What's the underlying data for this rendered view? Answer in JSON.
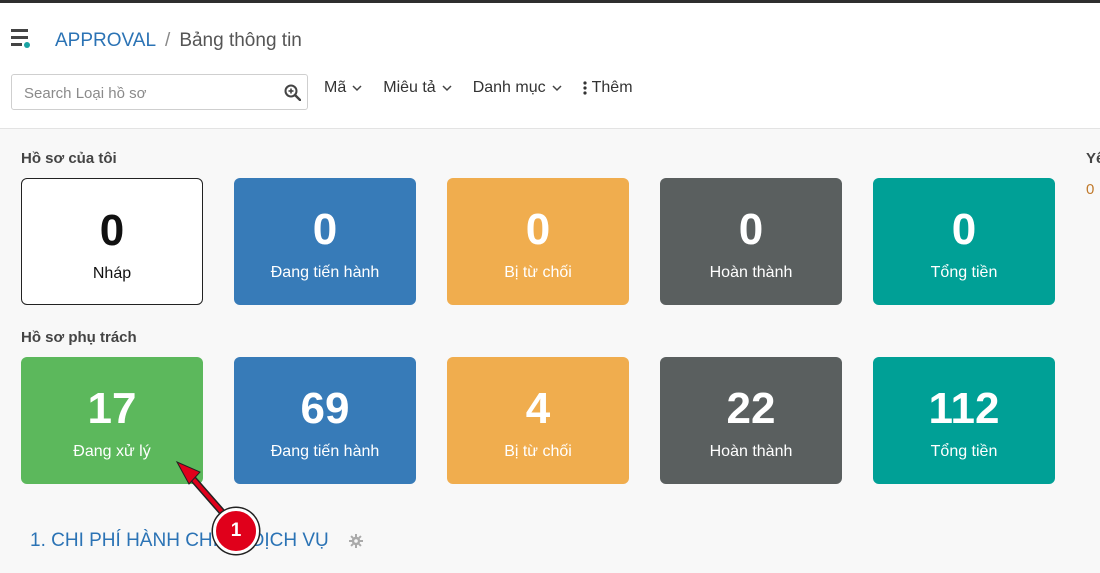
{
  "breadcrumb": {
    "root": "APPROVAL",
    "separator": "/",
    "current": "Bảng thông tin"
  },
  "search": {
    "placeholder": "Search Loại hồ sơ",
    "value": ""
  },
  "filters": [
    {
      "label": "Mã",
      "icon": "chevron-down-icon"
    },
    {
      "label": "Miêu tả",
      "icon": "chevron-down-icon"
    },
    {
      "label": "Danh mục",
      "icon": "chevron-down-icon"
    }
  ],
  "more": {
    "label": "Thêm",
    "icon": "vertical-dots-icon"
  },
  "my_records": {
    "title": "Hồ sơ của tôi",
    "cards": [
      {
        "value": "0",
        "label": "Nháp",
        "color": "#ffffff"
      },
      {
        "value": "0",
        "label": "Đang tiến hành",
        "color": "#377bb8"
      },
      {
        "value": "0",
        "label": "Bị từ chối",
        "color": "#f0ad4e"
      },
      {
        "value": "0",
        "label": "Hoàn thành",
        "color": "#5a5f5f"
      },
      {
        "value": "0",
        "label": "Tổng tiền",
        "color": "#00a096"
      }
    ]
  },
  "assigned_records": {
    "title": "Hồ sơ phụ trách",
    "cards": [
      {
        "value": "17",
        "label": "Đang xử lý",
        "color": "#5cb85c"
      },
      {
        "value": "69",
        "label": "Đang tiến hành",
        "color": "#377bb8"
      },
      {
        "value": "4",
        "label": "Bị từ chối",
        "color": "#f0ad4e"
      },
      {
        "value": "22",
        "label": "Hoàn thành",
        "color": "#5a5f5f"
      },
      {
        "value": "112",
        "label": "Tổng tiền",
        "color": "#00a096"
      }
    ]
  },
  "right_panel": {
    "label": "Yê",
    "value": "0"
  },
  "section": {
    "title": "1. CHI PHÍ HÀNH CHÍNH DỊCH VỤ"
  },
  "annotation": {
    "number": "1",
    "color": "#e0001b"
  }
}
